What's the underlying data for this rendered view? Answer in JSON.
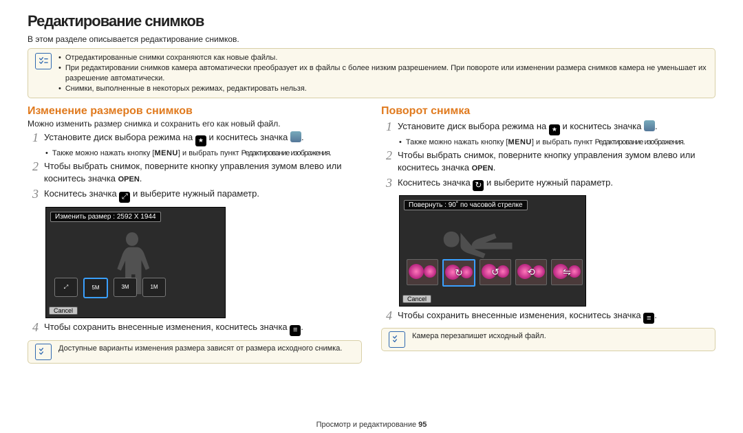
{
  "title": "Редактирование снимков",
  "intro": "В этом разделе описывается редактирование снимков.",
  "topbox": {
    "l1": "Отредактированные снимки сохраняются как новые файлы.",
    "l2": "При редактировании снимков камера автоматически преобразует их в файлы с более низким разрешением. При повороте или изменении размера снимков камера не уменьшает их разрешение автоматически.",
    "l3": "Снимки, выполненные в некоторых режимах, редактировать нельзя."
  },
  "left": {
    "h2": "Изменение размеров снимков",
    "sub": "Можно изменить размер снимка и сохранить его как новый файл.",
    "s1a": "Установите диск выбора режима на ",
    "s1b": " и коснитесь значка ",
    "s1c": ".",
    "s1_sub_a": "Также можно нажать кнопку [",
    "menu": "MENU",
    "s1_sub_b": "] и выбрать пункт ",
    "s1_sub_c": "Редактирование изображения",
    "s1_sub_d": ".",
    "s2": "Чтобы выбрать снимок, поверните кнопку управления зумом влево или коснитесь значка ",
    "open": "OPEN",
    "s2b": ".",
    "s3a": "Коснитесь значка ",
    "s3b": " и выберите нужный параметр.",
    "caption": "Изменить размер : 2592 X 1944",
    "sizes": [
      "⤢",
      "5M",
      "3M",
      "1M"
    ],
    "cancel": "Cancel",
    "s4a": "Чтобы сохранить внесенные изменения, коснитесь значка ",
    "s4b": ".",
    "note": "Доступные варианты изменения размера зависят от размера исходного снимка."
  },
  "right": {
    "h2": "Поворот снимка",
    "s1a": "Установите диск выбора режима на ",
    "s1b": " и коснитесь значка ",
    "s1c": ".",
    "s1_sub_a": "Также можно нажать кнопку [",
    "menu": "MENU",
    "s1_sub_b": "] и выбрать пункт ",
    "s1_sub_c": "Редактирование изображения",
    "s1_sub_d": ".",
    "s2": "Чтобы выбрать снимок, поверните кнопку управления зумом влево или коснитесь значка ",
    "open": "OPEN",
    "s2b": ".",
    "s3a": "Коснитесь значка ",
    "s3b": " и выберите нужный параметр.",
    "caption": "Повернуть : 90˚ по часовой стрелке",
    "cancel": "Cancel",
    "s4a": "Чтобы сохранить внесенные изменения, коснитесь значка ",
    "s4b": ".",
    "note": "Камера перезапишет исходный файл."
  },
  "footer_a": "Просмотр и редактирование ",
  "footer_pg": "95"
}
